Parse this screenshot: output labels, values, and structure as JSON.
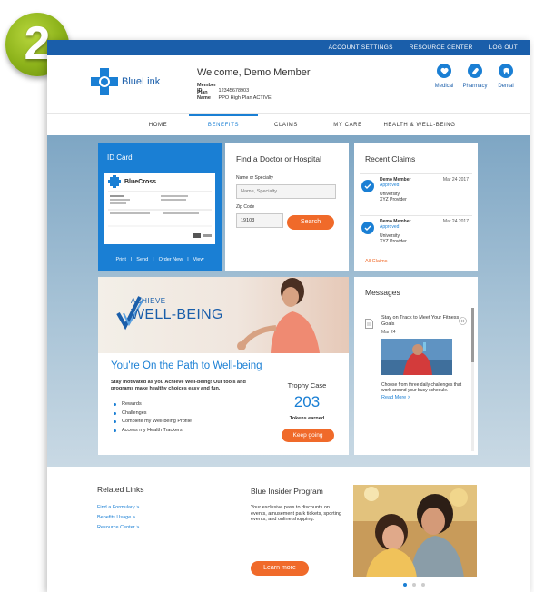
{
  "step_badge": "2",
  "topbar": {
    "links": [
      "ACCOUNT SETTINGS",
      "RESOURCE CENTER",
      "LOG OUT"
    ],
    "color": "#1a5eaa"
  },
  "header": {
    "brand": "BlueLink",
    "welcome": "Welcome, Demo Member",
    "member_id_label": "Member ID",
    "member_id": "12345678903",
    "plan_name_label": "Plan Name",
    "plan_name": "PPO High Plan ACTIVE",
    "quick_links": [
      {
        "label": "Medical",
        "icon": "heart-icon"
      },
      {
        "label": "Pharmacy",
        "icon": "pill-icon"
      },
      {
        "label": "Dental",
        "icon": "tooth-icon"
      }
    ]
  },
  "nav": {
    "items": [
      "HOME",
      "BENEFITS",
      "CLAIMS",
      "MY CARE",
      "HEALTH & WELL-BEING"
    ],
    "active": "BENEFITS"
  },
  "id_card": {
    "title": "ID Card",
    "brand": "BlueCross",
    "actions": [
      "Print",
      "Send",
      "Order New",
      "View"
    ],
    "separator": "|"
  },
  "find_doctor": {
    "title": "Find a Doctor or Hospital",
    "name_label": "Name or Specialty",
    "name_placeholder": "Name, Specialty",
    "zip_label": "Zip Code",
    "zip_value": "19103",
    "search_label": "Search"
  },
  "recent_claims": {
    "title": "Recent Claims",
    "claims": [
      {
        "member": "Demo Member",
        "status": "Approved",
        "date": "Mar 24 2017",
        "provider_line1": "University",
        "provider_line2": "XYZ Provider"
      },
      {
        "member": "Demo Member",
        "status": "Approved",
        "date": "Mar 24 2017",
        "provider_line1": "University",
        "provider_line2": "XYZ Provider"
      }
    ],
    "all_label": "All Claims"
  },
  "wellbeing": {
    "achieve": "ACHIEVE",
    "wellbeing": "WELL-BEING",
    "heading": "You're On the Path to Well-being",
    "description": "Stay motivated as you Achieve Well-being! Our tools and programs make healthy choices easy and fun.",
    "list": [
      "Rewards",
      "Challenges",
      "Complete my Well-being Profile",
      "Access my Health Trackers"
    ],
    "trophy_label": "Trophy Case",
    "tokens": "203",
    "tokens_label": "Tokens earned",
    "cta": "Keep going"
  },
  "messages": {
    "title": "Messages",
    "message_title": "Stay on Track to Meet Your Fitness Goals",
    "date": "Mar 24",
    "body": "Choose from three daily challenges that work around your busy schedule.",
    "read_more": "Read More >"
  },
  "footer": {
    "related_title": "Related Links",
    "related_links": [
      "Find a Formulary >",
      "Benefits Usage >",
      "Resource Center >"
    ],
    "insider_title": "Blue Insider Program",
    "insider_desc": "Your exclusive pass to discounts on events, amusement park tickets, sporting events, and online shopping.",
    "learn_more": "Learn more"
  },
  "colors": {
    "brand_blue": "#1a5eaa",
    "accent_blue": "#1a7fd4",
    "accent_orange": "#f06a2a",
    "badge_green": "#8cb21a"
  }
}
